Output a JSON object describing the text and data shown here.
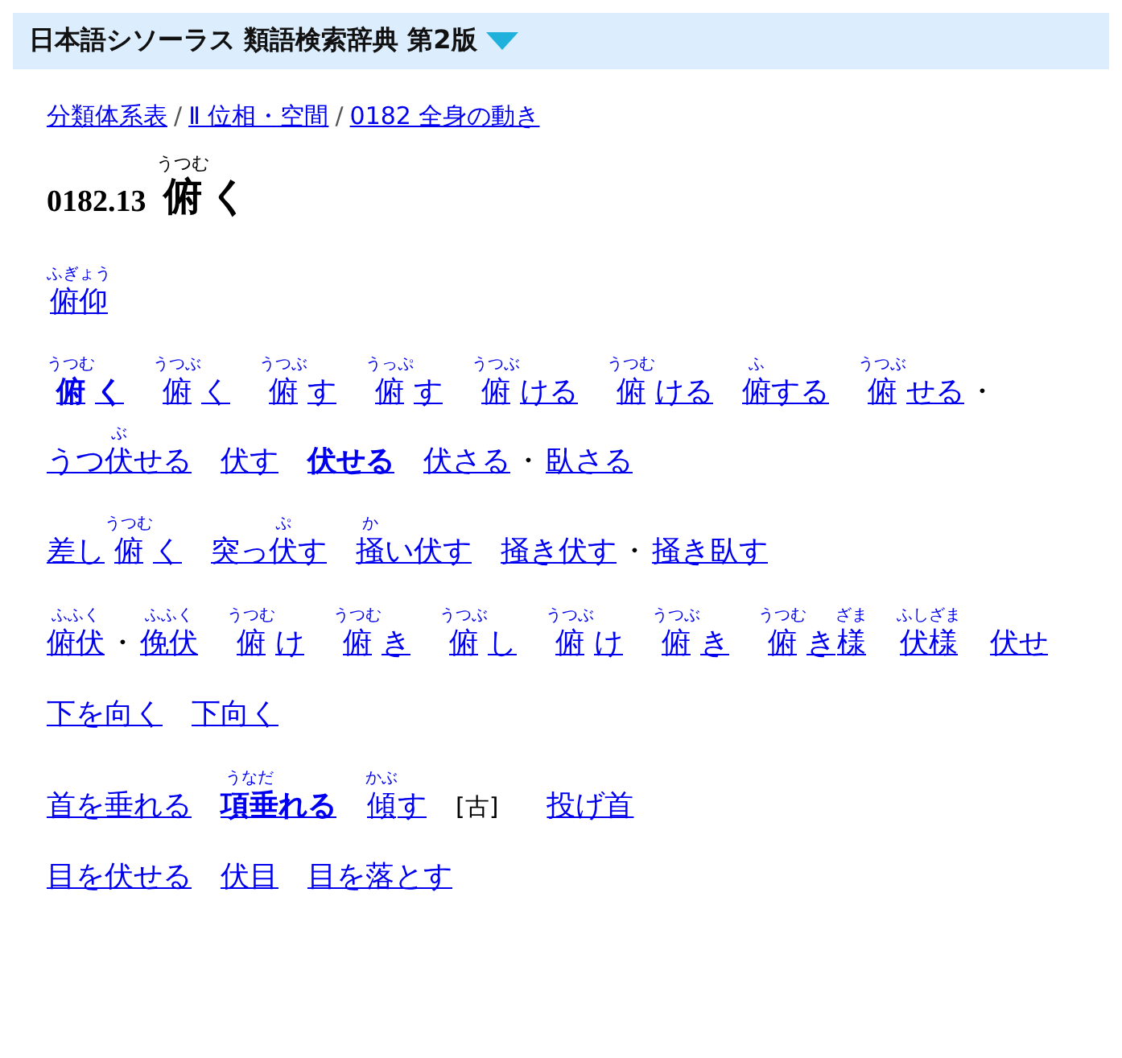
{
  "header": {
    "title": "日本語シソーラス 類語検索辞典 第2版"
  },
  "breadcrumbs": [
    {
      "kind": "link",
      "text": "分類体系表"
    },
    {
      "kind": "separator",
      "text": "/"
    },
    {
      "kind": "link",
      "text": "Ⅱ 位相・空間"
    },
    {
      "kind": "separator",
      "text": "/"
    },
    {
      "kind": "link",
      "text": "0182 全身の動き"
    }
  ],
  "heading": {
    "number": "0182.13",
    "parts": [
      {
        "text": "俯",
        "ruby": "うつむ"
      },
      {
        "text": "く"
      }
    ]
  },
  "groups": [
    [
      {
        "kind": "link",
        "bold": false,
        "parts": [
          {
            "text": "俯仰",
            "ruby": "ふぎょう"
          }
        ]
      }
    ],
    [
      {
        "kind": "link",
        "bold": true,
        "parts": [
          {
            "text": "俯",
            "ruby": "うつむ"
          },
          {
            "text": "く"
          }
        ]
      },
      {
        "kind": "link",
        "bold": false,
        "parts": [
          {
            "text": "俯",
            "ruby": "うつぶ"
          },
          {
            "text": "く"
          }
        ]
      },
      {
        "kind": "link",
        "bold": false,
        "parts": [
          {
            "text": "俯",
            "ruby": "うつぶ"
          },
          {
            "text": "す"
          }
        ]
      },
      {
        "kind": "link",
        "bold": false,
        "parts": [
          {
            "text": "俯",
            "ruby": "うっぷ"
          },
          {
            "text": "す"
          }
        ]
      },
      {
        "kind": "link",
        "bold": false,
        "parts": [
          {
            "text": "俯",
            "ruby": "うつぶ"
          },
          {
            "text": "ける"
          }
        ]
      },
      {
        "kind": "link",
        "bold": false,
        "parts": [
          {
            "text": "俯",
            "ruby": "うつむ"
          },
          {
            "text": "ける"
          }
        ]
      },
      {
        "kind": "link",
        "bold": false,
        "parts": [
          {
            "text": "俯",
            "ruby": "ふ"
          },
          {
            "text": "する"
          }
        ]
      },
      {
        "kind": "link",
        "bold": false,
        "parts": [
          {
            "text": "俯",
            "ruby": "うつぶ"
          },
          {
            "text": "せる"
          }
        ]
      },
      {
        "kind": "separator",
        "text": "・"
      },
      {
        "kind": "link",
        "bold": false,
        "parts": [
          {
            "text": "うつ"
          },
          {
            "text": "伏",
            "ruby": "ぶ"
          },
          {
            "text": "せる"
          }
        ]
      },
      {
        "kind": "link",
        "bold": false,
        "parts": [
          {
            "text": "伏す"
          }
        ]
      },
      {
        "kind": "link",
        "bold": true,
        "parts": [
          {
            "text": "伏せる"
          }
        ]
      },
      {
        "kind": "link",
        "bold": false,
        "parts": [
          {
            "text": "伏さる"
          }
        ]
      },
      {
        "kind": "separator",
        "text": "・"
      },
      {
        "kind": "link",
        "bold": false,
        "parts": [
          {
            "text": "臥さる"
          }
        ]
      }
    ],
    [
      {
        "kind": "link",
        "bold": false,
        "parts": [
          {
            "text": "差し"
          },
          {
            "text": "俯",
            "ruby": "うつむ"
          },
          {
            "text": "く"
          }
        ]
      },
      {
        "kind": "link",
        "bold": false,
        "parts": [
          {
            "text": "突っ"
          },
          {
            "text": "伏",
            "ruby": "ぷ"
          },
          {
            "text": "す"
          }
        ]
      },
      {
        "kind": "link",
        "bold": false,
        "parts": [
          {
            "text": "掻",
            "ruby": "か"
          },
          {
            "text": "い伏す"
          }
        ]
      },
      {
        "kind": "link",
        "bold": false,
        "parts": [
          {
            "text": "掻き伏す"
          }
        ]
      },
      {
        "kind": "separator",
        "text": "・"
      },
      {
        "kind": "link",
        "bold": false,
        "parts": [
          {
            "text": "掻き臥す"
          }
        ]
      }
    ],
    [
      {
        "kind": "link",
        "bold": false,
        "parts": [
          {
            "text": "俯伏",
            "ruby": "ふふく"
          }
        ]
      },
      {
        "kind": "separator",
        "text": "・"
      },
      {
        "kind": "link",
        "bold": false,
        "parts": [
          {
            "text": "俛伏",
            "ruby": "ふふく"
          }
        ]
      },
      {
        "kind": "link",
        "bold": false,
        "parts": [
          {
            "text": "俯",
            "ruby": "うつむ"
          },
          {
            "text": "け"
          }
        ]
      },
      {
        "kind": "link",
        "bold": false,
        "parts": [
          {
            "text": "俯",
            "ruby": "うつむ"
          },
          {
            "text": "き"
          }
        ]
      },
      {
        "kind": "link",
        "bold": false,
        "parts": [
          {
            "text": "俯",
            "ruby": "うつぶ"
          },
          {
            "text": "し"
          }
        ]
      },
      {
        "kind": "link",
        "bold": false,
        "parts": [
          {
            "text": "俯",
            "ruby": "うつぶ"
          },
          {
            "text": "け"
          }
        ]
      },
      {
        "kind": "link",
        "bold": false,
        "parts": [
          {
            "text": "俯",
            "ruby": "うつぶ"
          },
          {
            "text": "き"
          }
        ]
      },
      {
        "kind": "link",
        "bold": false,
        "parts": [
          {
            "text": "俯",
            "ruby": "うつむ"
          },
          {
            "text": "き"
          },
          {
            "text": "様",
            "ruby": "ざま"
          }
        ]
      },
      {
        "kind": "link",
        "bold": false,
        "parts": [
          {
            "text": "伏様",
            "ruby": "ふしざま"
          }
        ]
      },
      {
        "kind": "link",
        "bold": false,
        "parts": [
          {
            "text": "伏せ"
          }
        ]
      }
    ],
    [
      {
        "kind": "link",
        "bold": false,
        "parts": [
          {
            "text": "下を向く"
          }
        ]
      },
      {
        "kind": "link",
        "bold": false,
        "parts": [
          {
            "text": "下向く"
          }
        ]
      }
    ],
    [
      {
        "kind": "link",
        "bold": false,
        "parts": [
          {
            "text": "首を垂れる"
          }
        ]
      },
      {
        "kind": "link",
        "bold": true,
        "parts": [
          {
            "text": "項垂",
            "ruby": "うなだ"
          },
          {
            "text": "れる"
          }
        ]
      },
      {
        "kind": "link",
        "bold": false,
        "parts": [
          {
            "text": "傾",
            "ruby": "かぶ"
          },
          {
            "text": "す"
          }
        ]
      },
      {
        "kind": "note",
        "text": "[古]"
      },
      {
        "kind": "link",
        "bold": false,
        "parts": [
          {
            "text": "投げ首"
          }
        ]
      }
    ],
    [
      {
        "kind": "link",
        "bold": false,
        "parts": [
          {
            "text": "目を伏せる"
          }
        ]
      },
      {
        "kind": "link",
        "bold": false,
        "parts": [
          {
            "text": "伏目"
          }
        ]
      },
      {
        "kind": "link",
        "bold": false,
        "parts": [
          {
            "text": "目を落とす"
          }
        ]
      }
    ]
  ]
}
